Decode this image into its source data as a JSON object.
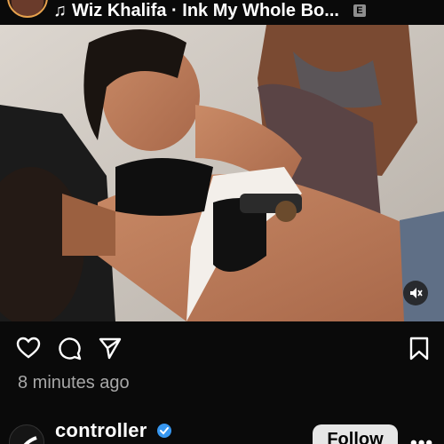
{
  "header": {
    "music_note_icon": "music-note-icon",
    "track": "Wiz Khalifa · Ink My Whole Bo...",
    "explicit_badge": "E"
  },
  "media": {
    "description_icon": "photo",
    "mute_icon": "speaker-muted-icon"
  },
  "actions": {
    "like_icon": "heart-icon",
    "comment_icon": "comment-icon",
    "share_icon": "send-icon",
    "save_icon": "bookmark-icon"
  },
  "post": {
    "timestamp": "8 minutes ago"
  },
  "author": {
    "username": "controller",
    "verified": true,
    "follow_label": "Follow",
    "more_label": "•••"
  },
  "colors": {
    "background": "#0a0a0a",
    "verified_blue": "#3797f0",
    "timestamp_gray": "#a8a8a8",
    "follow_bg": "#e6e6e6",
    "avatar_ring": "#e7a24d"
  }
}
